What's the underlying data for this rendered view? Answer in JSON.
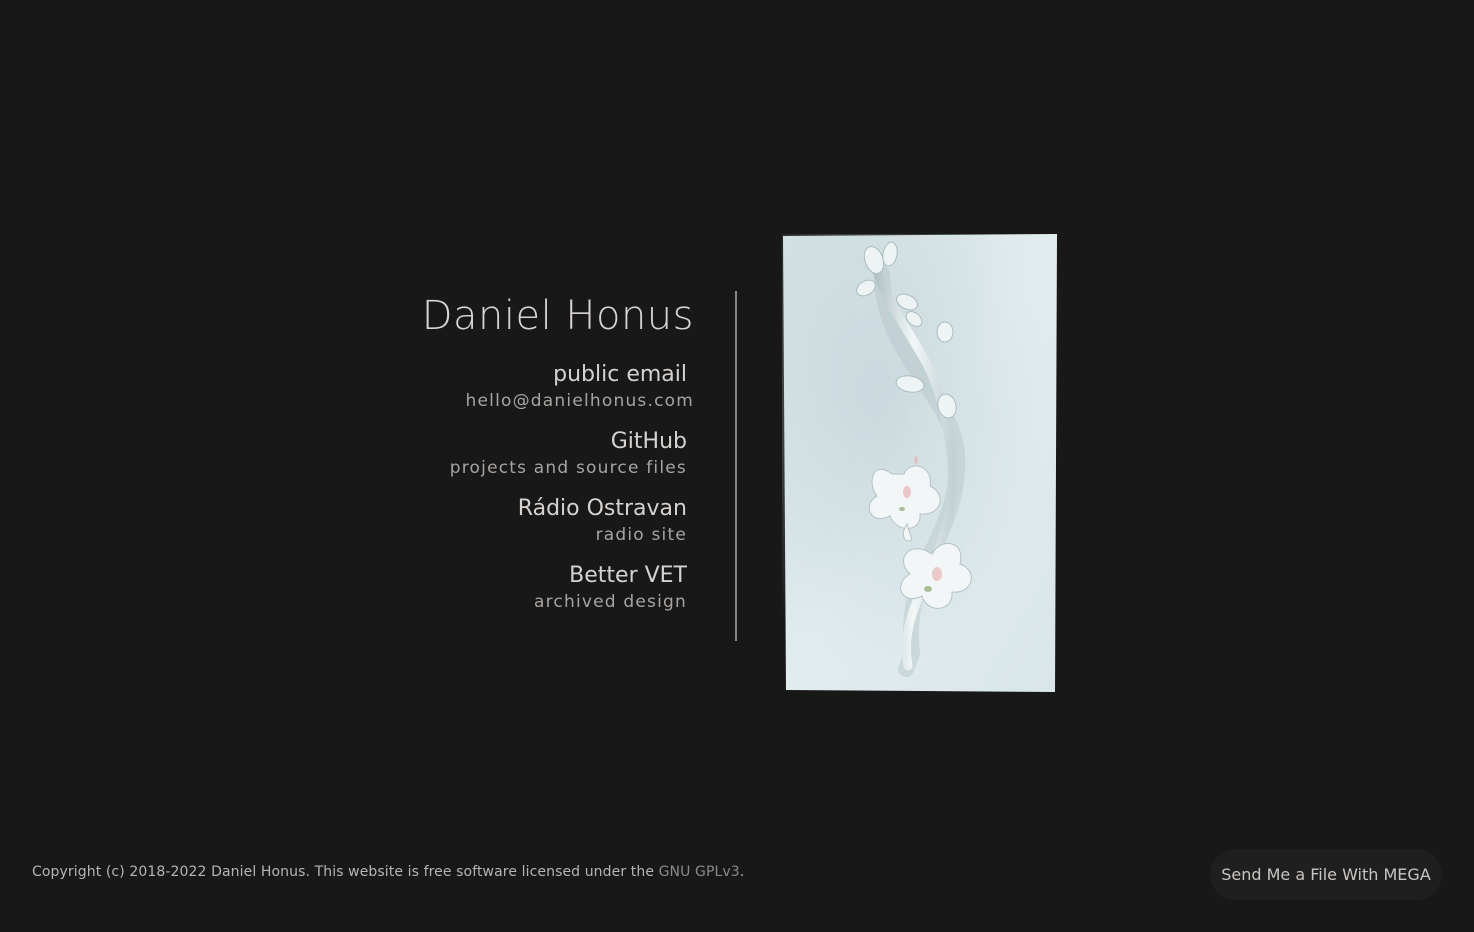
{
  "profile": {
    "name": "Daniel Honus"
  },
  "links": [
    {
      "title": "public email",
      "description": "hello@danielhonus.com"
    },
    {
      "title": "GitHub",
      "description": "projects and source files"
    },
    {
      "title": "Rádio Ostravan",
      "description": "radio site"
    },
    {
      "title": "Better VET",
      "description": "archived design"
    }
  ],
  "footer": {
    "copyright_text": "Copyright (c) 2018-2022 Daniel Honus. This website is free software licensed under the ",
    "license_link": "GNU GPLv3",
    "period": "."
  },
  "mega_button": {
    "label": "Send Me a File With MEGA"
  },
  "colors": {
    "background": "#181818",
    "text": "#d6d2cf",
    "muted": "#a8a4a1",
    "artwork_bg": "#dce8ea"
  },
  "artwork": {
    "icon": "flower-relief-image"
  }
}
